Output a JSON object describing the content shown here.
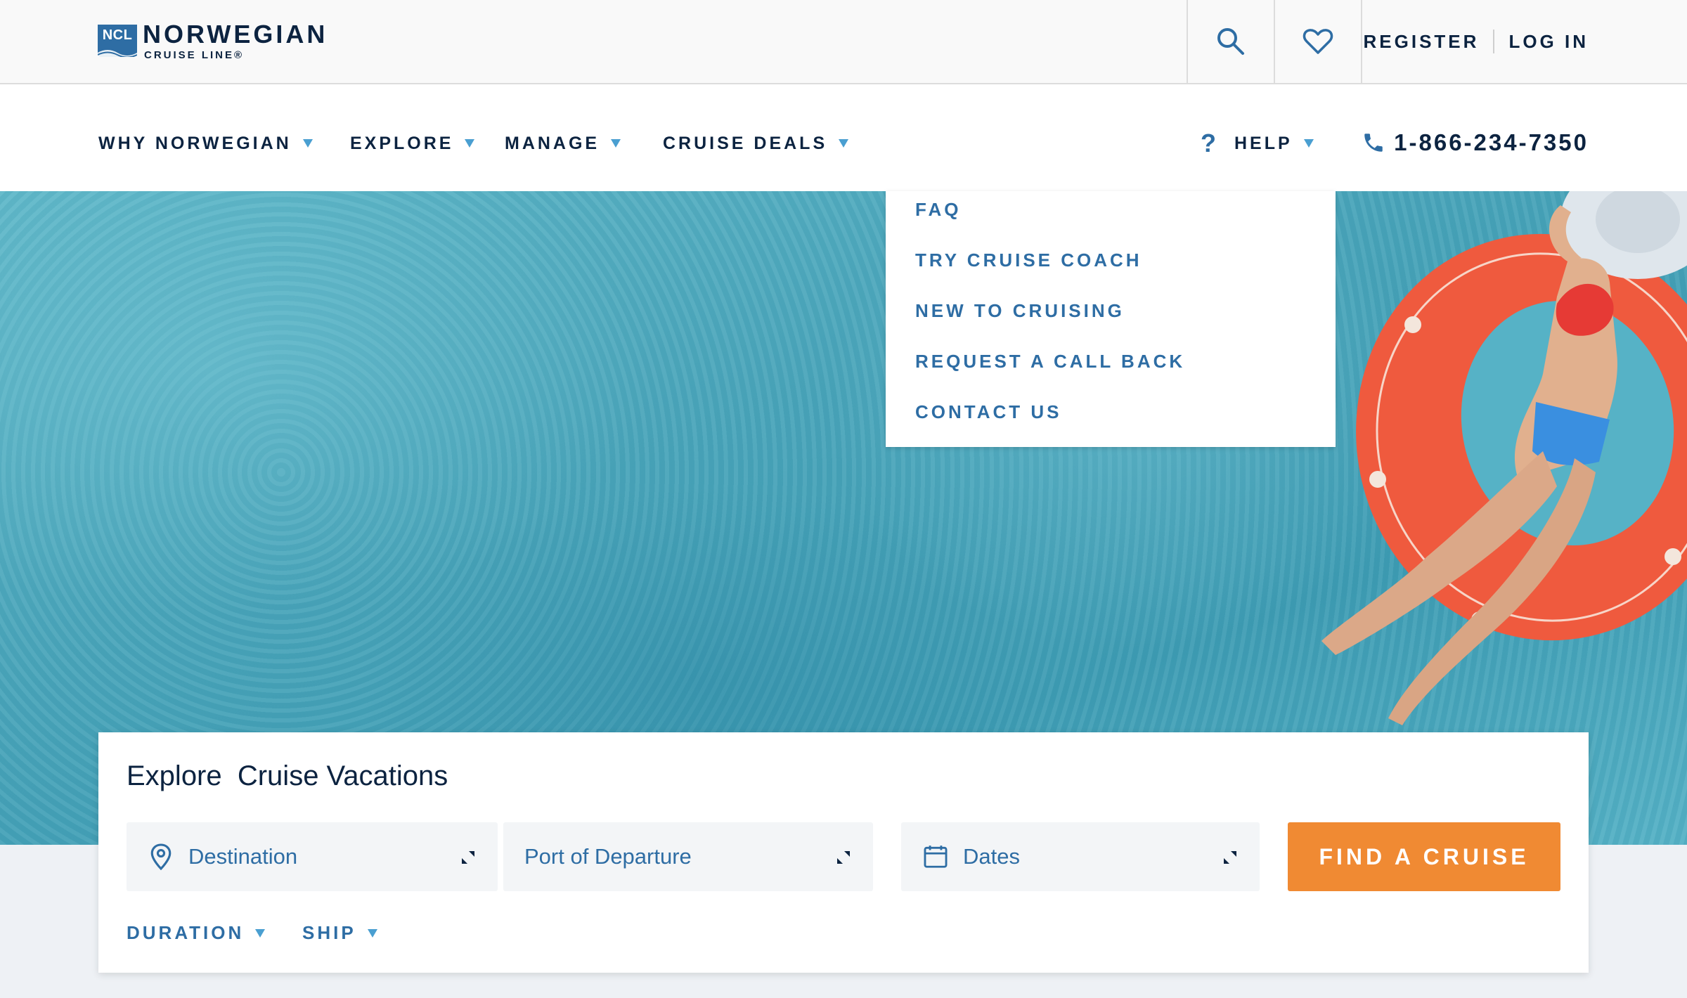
{
  "header": {
    "logo": {
      "badge": "NCL",
      "name": "NORWEGIAN",
      "sub": "CRUISE LINE®"
    },
    "search_icon": "search-icon",
    "favorites_icon": "heart-icon",
    "register_label": "REGISTER",
    "login_label": "LOG IN"
  },
  "nav": {
    "items": [
      {
        "label": "WHY NORWEGIAN"
      },
      {
        "label": "EXPLORE"
      },
      {
        "label": "MANAGE"
      },
      {
        "label": "CRUISE DEALS"
      }
    ],
    "help": {
      "icon": "?",
      "label": "HELP"
    },
    "phone": "1-866-234-7350"
  },
  "help_menu": {
    "items": [
      {
        "label": "FAQ"
      },
      {
        "label": "TRY CRUISE COACH"
      },
      {
        "label": "NEW TO CRUISING"
      },
      {
        "label": "REQUEST A CALL BACK"
      },
      {
        "label": "CONTACT US"
      }
    ]
  },
  "search": {
    "title": "Explore  Cruise Vacations",
    "destination_label": "Destination",
    "port_label": "Port of Departure",
    "dates_label": "Dates",
    "find_button": "FIND A CRUISE",
    "duration_label": "DURATION",
    "ship_label": "SHIP"
  },
  "colors": {
    "navy": "#0c2340",
    "blue": "#2e6da4",
    "accent_orange": "#f08a33",
    "caret_blue": "#4a9fd1"
  }
}
